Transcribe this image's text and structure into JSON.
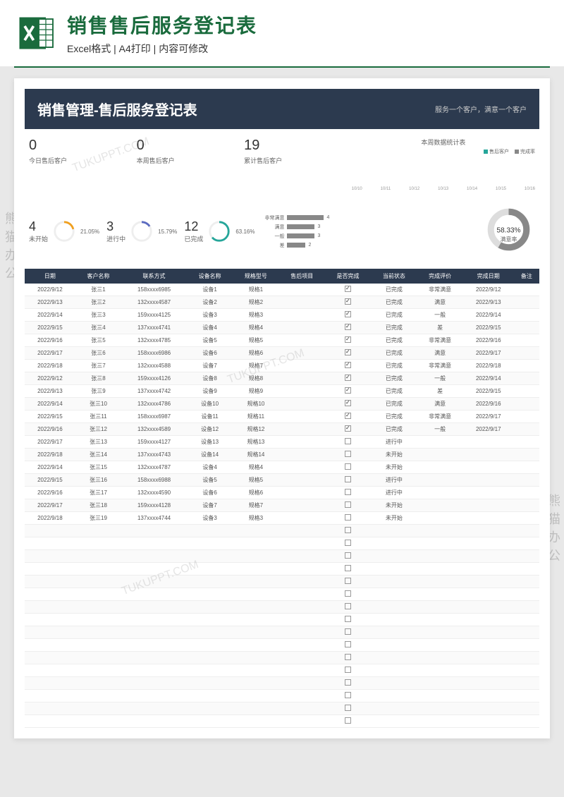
{
  "header": {
    "main_title": "销售售后服务登记表",
    "features": "Excel格式 | A4打印 | 内容可修改"
  },
  "doc": {
    "title": "销售管理-售后服务登记表",
    "slogan": "服务一个客户，满意一个客户"
  },
  "stats": {
    "today_num": "0",
    "today_label": "今日售后客户",
    "week_num": "0",
    "week_label": "本周售后客户",
    "total_num": "19",
    "total_label": "累计售后客户"
  },
  "weekly_chart": {
    "title": "本周数据统计表",
    "legend_customers": "售后客户",
    "legend_rate": "完成率",
    "x_labels": [
      "10/10",
      "10/11",
      "10/12",
      "10/13",
      "10/14",
      "10/15",
      "10/16"
    ]
  },
  "status": {
    "not_started_num": "4",
    "not_started_label": "未开始",
    "not_started_pct": "21.05%",
    "in_progress_num": "3",
    "in_progress_label": "进行中",
    "in_progress_pct": "15.79%",
    "completed_num": "12",
    "completed_label": "已完成",
    "completed_pct": "63.16%"
  },
  "ratings": {
    "very_satisfied_label": "非常满意",
    "very_satisfied_val": "4",
    "satisfied_label": "满意",
    "satisfied_val": "3",
    "normal_label": "一般",
    "normal_val": "3",
    "poor_label": "差",
    "poor_val": "2"
  },
  "satisfaction": {
    "pct": "58.33%",
    "label": "满意率"
  },
  "columns": [
    "日期",
    "客户名称",
    "联系方式",
    "设备名称",
    "规格型号",
    "售后项目",
    "是否完成",
    "当前状态",
    "完成评价",
    "完成日期",
    "备注"
  ],
  "rows": [
    {
      "date": "2022/9/12",
      "name": "张三1",
      "phone": "158xxxx6985",
      "device": "设备1",
      "spec": "规格1",
      "item": "",
      "done": true,
      "status": "已完成",
      "rating": "非常满意",
      "cdate": "2022/9/12",
      "remark": ""
    },
    {
      "date": "2022/9/13",
      "name": "张三2",
      "phone": "132xxxx4587",
      "device": "设备2",
      "spec": "规格2",
      "item": "",
      "done": true,
      "status": "已完成",
      "rating": "满意",
      "cdate": "2022/9/13",
      "remark": ""
    },
    {
      "date": "2022/9/14",
      "name": "张三3",
      "phone": "159xxxx4125",
      "device": "设备3",
      "spec": "规格3",
      "item": "",
      "done": true,
      "status": "已完成",
      "rating": "一般",
      "cdate": "2022/9/14",
      "remark": ""
    },
    {
      "date": "2022/9/15",
      "name": "张三4",
      "phone": "137xxxx4741",
      "device": "设备4",
      "spec": "规格4",
      "item": "",
      "done": true,
      "status": "已完成",
      "rating": "差",
      "cdate": "2022/9/15",
      "remark": ""
    },
    {
      "date": "2022/9/16",
      "name": "张三5",
      "phone": "132xxxx4785",
      "device": "设备5",
      "spec": "规格5",
      "item": "",
      "done": true,
      "status": "已完成",
      "rating": "非常满意",
      "cdate": "2022/9/16",
      "remark": ""
    },
    {
      "date": "2022/9/17",
      "name": "张三6",
      "phone": "158xxxx6986",
      "device": "设备6",
      "spec": "规格6",
      "item": "",
      "done": true,
      "status": "已完成",
      "rating": "满意",
      "cdate": "2022/9/17",
      "remark": ""
    },
    {
      "date": "2022/9/18",
      "name": "张三7",
      "phone": "132xxxx4588",
      "device": "设备7",
      "spec": "规格7",
      "item": "",
      "done": true,
      "status": "已完成",
      "rating": "非常满意",
      "cdate": "2022/9/18",
      "remark": ""
    },
    {
      "date": "2022/9/12",
      "name": "张三8",
      "phone": "159xxxx4126",
      "device": "设备8",
      "spec": "规格8",
      "item": "",
      "done": true,
      "status": "已完成",
      "rating": "一般",
      "cdate": "2022/9/14",
      "remark": ""
    },
    {
      "date": "2022/9/13",
      "name": "张三9",
      "phone": "137xxxx4742",
      "device": "设备9",
      "spec": "规格9",
      "item": "",
      "done": true,
      "status": "已完成",
      "rating": "差",
      "cdate": "2022/9/15",
      "remark": ""
    },
    {
      "date": "2022/9/14",
      "name": "张三10",
      "phone": "132xxxx4786",
      "device": "设备10",
      "spec": "规格10",
      "item": "",
      "done": true,
      "status": "已完成",
      "rating": "满意",
      "cdate": "2022/9/16",
      "remark": ""
    },
    {
      "date": "2022/9/15",
      "name": "张三11",
      "phone": "158xxxx6987",
      "device": "设备11",
      "spec": "规格11",
      "item": "",
      "done": true,
      "status": "已完成",
      "rating": "非常满意",
      "cdate": "2022/9/17",
      "remark": ""
    },
    {
      "date": "2022/9/16",
      "name": "张三12",
      "phone": "132xxxx4589",
      "device": "设备12",
      "spec": "规格12",
      "item": "",
      "done": true,
      "status": "已完成",
      "rating": "一般",
      "cdate": "2022/9/17",
      "remark": ""
    },
    {
      "date": "2022/9/17",
      "name": "张三13",
      "phone": "159xxxx4127",
      "device": "设备13",
      "spec": "规格13",
      "item": "",
      "done": false,
      "status": "进行中",
      "rating": "",
      "cdate": "",
      "remark": ""
    },
    {
      "date": "2022/9/18",
      "name": "张三14",
      "phone": "137xxxx4743",
      "device": "设备14",
      "spec": "规格14",
      "item": "",
      "done": false,
      "status": "未开始",
      "rating": "",
      "cdate": "",
      "remark": ""
    },
    {
      "date": "2022/9/14",
      "name": "张三15",
      "phone": "132xxxx4787",
      "device": "设备4",
      "spec": "规格4",
      "item": "",
      "done": false,
      "status": "未开始",
      "rating": "",
      "cdate": "",
      "remark": ""
    },
    {
      "date": "2022/9/15",
      "name": "张三16",
      "phone": "158xxxx6988",
      "device": "设备5",
      "spec": "规格5",
      "item": "",
      "done": false,
      "status": "进行中",
      "rating": "",
      "cdate": "",
      "remark": ""
    },
    {
      "date": "2022/9/16",
      "name": "张三17",
      "phone": "132xxxx4590",
      "device": "设备6",
      "spec": "规格6",
      "item": "",
      "done": false,
      "status": "进行中",
      "rating": "",
      "cdate": "",
      "remark": ""
    },
    {
      "date": "2022/9/17",
      "name": "张三18",
      "phone": "159xxxx4128",
      "device": "设备7",
      "spec": "规格7",
      "item": "",
      "done": false,
      "status": "未开始",
      "rating": "",
      "cdate": "",
      "remark": ""
    },
    {
      "date": "2022/9/18",
      "name": "张三19",
      "phone": "137xxxx4744",
      "device": "设备3",
      "spec": "规格3",
      "item": "",
      "done": false,
      "status": "未开始",
      "rating": "",
      "cdate": "",
      "remark": ""
    }
  ],
  "empty_rows": 16,
  "chart_data": {
    "type": "composite",
    "weekly": {
      "type": "line",
      "x": [
        "10/10",
        "10/11",
        "10/12",
        "10/13",
        "10/14",
        "10/15",
        "10/16"
      ],
      "series": [
        {
          "name": "售后客户",
          "values": [
            0,
            0,
            0,
            0,
            0,
            0,
            0
          ]
        },
        {
          "name": "完成率",
          "values": [
            0,
            0,
            0,
            0,
            0,
            0,
            0
          ]
        }
      ]
    },
    "status_donuts": [
      {
        "label": "未开始",
        "value": 4,
        "pct": 21.05
      },
      {
        "label": "进行中",
        "value": 3,
        "pct": 15.79
      },
      {
        "label": "已完成",
        "value": 12,
        "pct": 63.16
      }
    ],
    "ratings_bar": {
      "type": "bar",
      "categories": [
        "非常满意",
        "满意",
        "一般",
        "差"
      ],
      "values": [
        4,
        3,
        3,
        2
      ]
    },
    "satisfaction_donut": {
      "pct": 58.33,
      "label": "满意率"
    }
  }
}
